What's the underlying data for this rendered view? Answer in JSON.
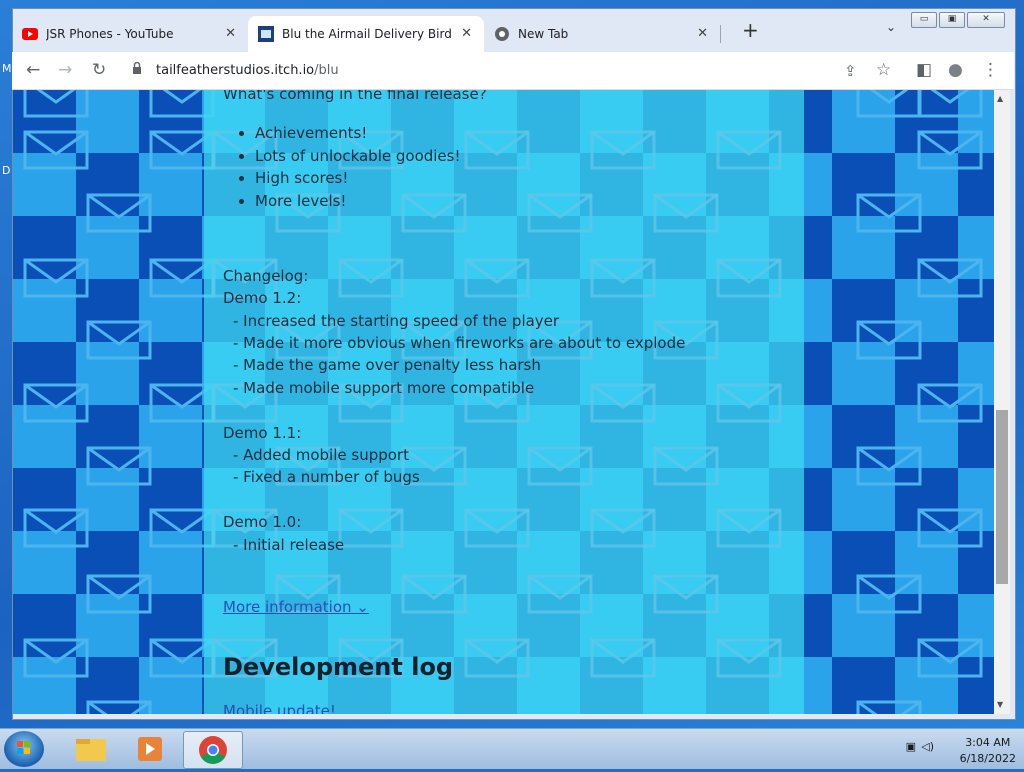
{
  "desktop": {
    "letters": [
      "M",
      "D"
    ]
  },
  "browser": {
    "tabs": [
      {
        "title": "JSR Phones - YouTube",
        "icon": "youtube-icon",
        "close": "✕"
      },
      {
        "title": "Blu the Airmail Delivery Bird (PC",
        "icon": "game-thumbnail-icon",
        "close": "✕"
      },
      {
        "title": "New Tab",
        "icon": "chrome-icon",
        "close": "✕"
      }
    ],
    "new_tab": "+",
    "tab_menu": "⌄",
    "window_controls": {
      "minimize": "▭",
      "maximize": "▣",
      "close": "✕"
    },
    "toolbar": {
      "back": "←",
      "forward": "→",
      "reload": "↻",
      "url_host": "tailfeatherstudios.itch.io",
      "url_path": "/blu",
      "share": "⇪",
      "star": "☆",
      "sidepanel": "◧",
      "profile": "●",
      "menu": "⋮"
    }
  },
  "page": {
    "coming_heading": "What's coming in the final release?",
    "features": [
      "Achievements!",
      "Lots of unlockable goodies!",
      "High scores!",
      "More levels!"
    ],
    "changelog_title": "Changelog:",
    "demo12": {
      "title": "Demo 1.2:",
      "items": [
        "- Increased the starting speed of the player",
        "- Made it more obvious when fireworks are about to explode",
        "- Made the game over penalty less harsh",
        "- Made mobile support more compatible"
      ]
    },
    "demo11": {
      "title": "Demo 1.1:",
      "items": [
        "- Added mobile support",
        "- Fixed a number of bugs"
      ]
    },
    "demo10": {
      "title": "Demo 1.0:",
      "items": [
        "- Initial release"
      ]
    },
    "more_info": "More information ⌄",
    "devlog_heading": "Development log",
    "devlog_first": "Mobile update!"
  },
  "taskbar": {
    "time": "3:04 AM",
    "date": "6/18/2022"
  }
}
